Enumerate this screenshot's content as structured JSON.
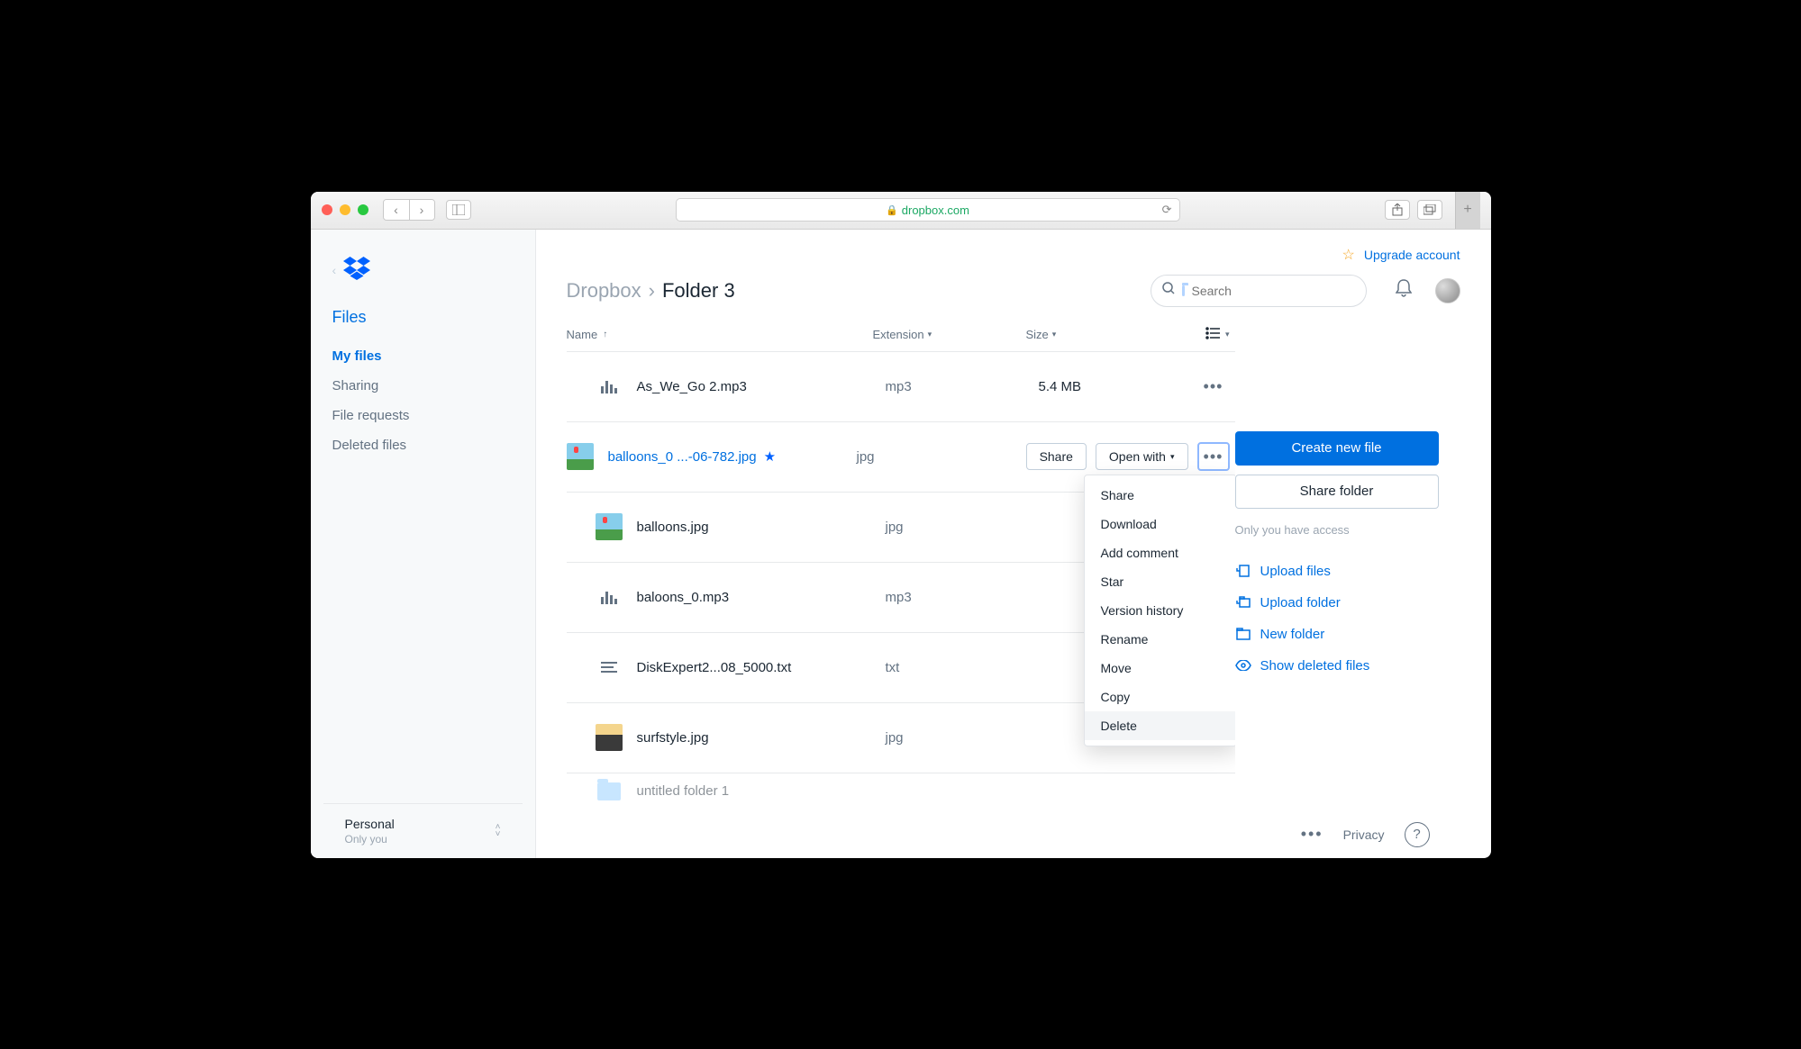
{
  "browser": {
    "url_host": "dropbox.com"
  },
  "upgrade_label": "Upgrade account",
  "search_placeholder": "Search",
  "breadcrumb": {
    "root": "Dropbox",
    "current": "Folder 3"
  },
  "sidebar": {
    "section": "Files",
    "items": [
      "My files",
      "Sharing",
      "File requests",
      "Deleted files"
    ],
    "footer_title": "Personal",
    "footer_sub": "Only you"
  },
  "columns": {
    "name": "Name",
    "ext": "Extension",
    "size": "Size"
  },
  "files": [
    {
      "name": "As_We_Go 2.mp3",
      "ext": "mp3",
      "size": "5.4 MB",
      "icon": "audio"
    },
    {
      "name": "balloons_0 ...-06-782.jpg",
      "ext": "jpg",
      "size": "",
      "icon": "thumb",
      "selected": true,
      "starred": true
    },
    {
      "name": "balloons.jpg",
      "ext": "jpg",
      "size": "",
      "icon": "thumb"
    },
    {
      "name": "baloons_0.mp3",
      "ext": "mp3",
      "size": "",
      "icon": "audio"
    },
    {
      "name": "DiskExpert2...08_5000.txt",
      "ext": "txt",
      "size": "",
      "icon": "text"
    },
    {
      "name": "surfstyle.jpg",
      "ext": "jpg",
      "size": "",
      "icon": "surf"
    },
    {
      "name": "untitled folder 1",
      "ext": "",
      "size": "",
      "icon": "folder"
    }
  ],
  "row_buttons": {
    "share": "Share",
    "open_with": "Open with"
  },
  "context_menu": [
    "Share",
    "Download",
    "Add comment",
    "Star",
    "Version history",
    "Rename",
    "Move",
    "Copy",
    "Delete"
  ],
  "right_panel": {
    "create": "Create new file",
    "share": "Share folder",
    "access_note": "Only you have access",
    "actions": [
      "Upload files",
      "Upload folder",
      "New folder",
      "Show deleted files"
    ]
  },
  "footer": {
    "privacy": "Privacy"
  }
}
